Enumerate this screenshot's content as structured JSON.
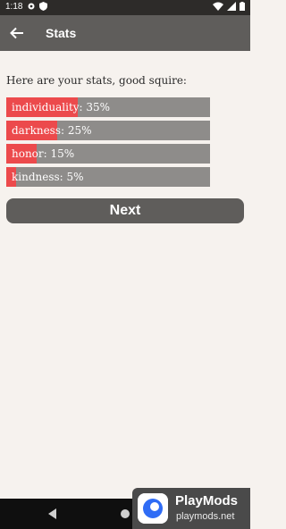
{
  "status_bar": {
    "time": "1:18"
  },
  "app_bar": {
    "title": "Stats"
  },
  "intro_text": "Here are your stats, good squire:",
  "stats": [
    {
      "name": "individuality",
      "percent": 35,
      "label": "individuality: 35%"
    },
    {
      "name": "darkness",
      "percent": 25,
      "label": "darkness: 25%"
    },
    {
      "name": "honor",
      "percent": 15,
      "label": "honor: 15%"
    },
    {
      "name": "kindness",
      "percent": 5,
      "label": "kindness: 5%"
    }
  ],
  "next_button": {
    "label": "Next"
  },
  "watermark": {
    "title": "PlayMods",
    "url": "playmods.net"
  },
  "colors": {
    "fill": "#ec4a4c",
    "track": "#8e8c8a",
    "app_bar": "#5f5d5b",
    "background": "#f6f2ee"
  }
}
